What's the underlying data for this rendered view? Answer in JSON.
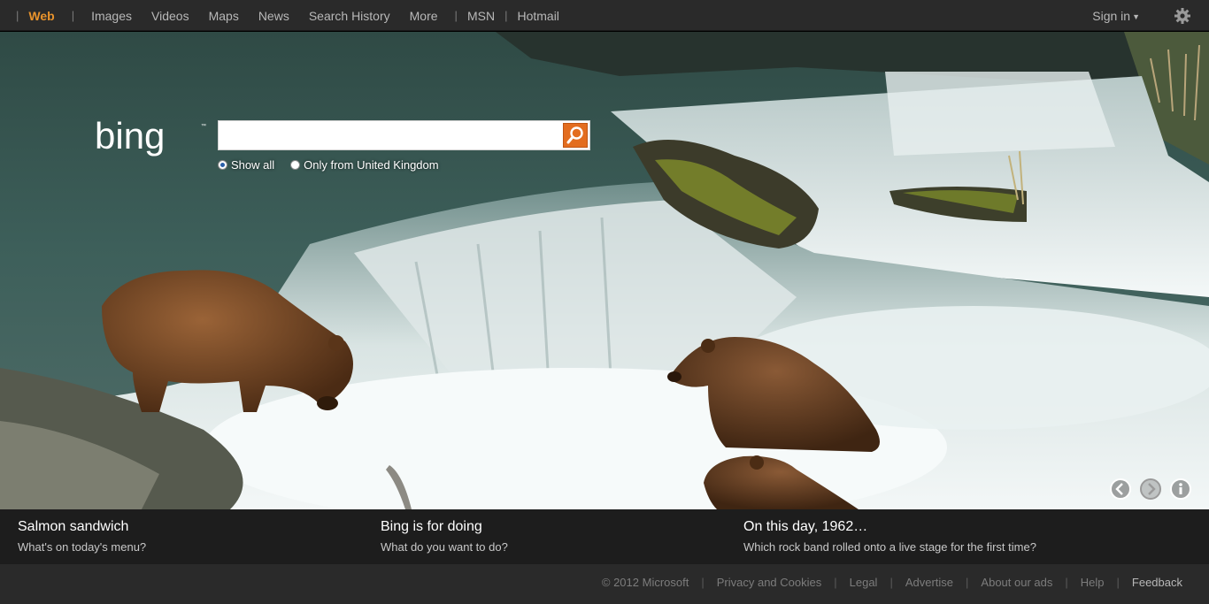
{
  "nav": {
    "items": [
      {
        "label": "Web",
        "active": true
      },
      {
        "label": "Images"
      },
      {
        "label": "Videos"
      },
      {
        "label": "Maps"
      },
      {
        "label": "News"
      },
      {
        "label": "Search History"
      },
      {
        "label": "More"
      }
    ],
    "extra": [
      {
        "label": "MSN"
      },
      {
        "label": "Hotmail"
      }
    ],
    "signin": "Sign in",
    "settings_icon": "gear-icon"
  },
  "brand": {
    "logo_text": "bing"
  },
  "search": {
    "value": "",
    "placeholder": "",
    "button_icon": "magnifier-icon",
    "accent": "#e36d1f",
    "scope_options": [
      {
        "label": "Show all",
        "selected": true
      },
      {
        "label": "Only from United Kingdom",
        "selected": false
      }
    ]
  },
  "hero": {
    "controls": [
      "previous-icon",
      "next-icon",
      "info-icon"
    ]
  },
  "captions": [
    {
      "title": "Salmon sandwich",
      "subtitle": "What's on today's menu?"
    },
    {
      "title": "Bing is for doing",
      "subtitle": "What do you want to do?"
    },
    {
      "title": "On this day, 1962…",
      "subtitle": "Which rock band rolled onto a live stage for the first time?"
    }
  ],
  "footer": {
    "copyright": "© 2012 Microsoft",
    "links": [
      "Privacy and Cookies",
      "Legal",
      "Advertise",
      "About our ads",
      "Help"
    ],
    "feedback": "Feedback"
  },
  "colors": {
    "active_nav": "#e8932c",
    "topbar": "#2a2a2a",
    "search_button": "#e36d1f"
  }
}
